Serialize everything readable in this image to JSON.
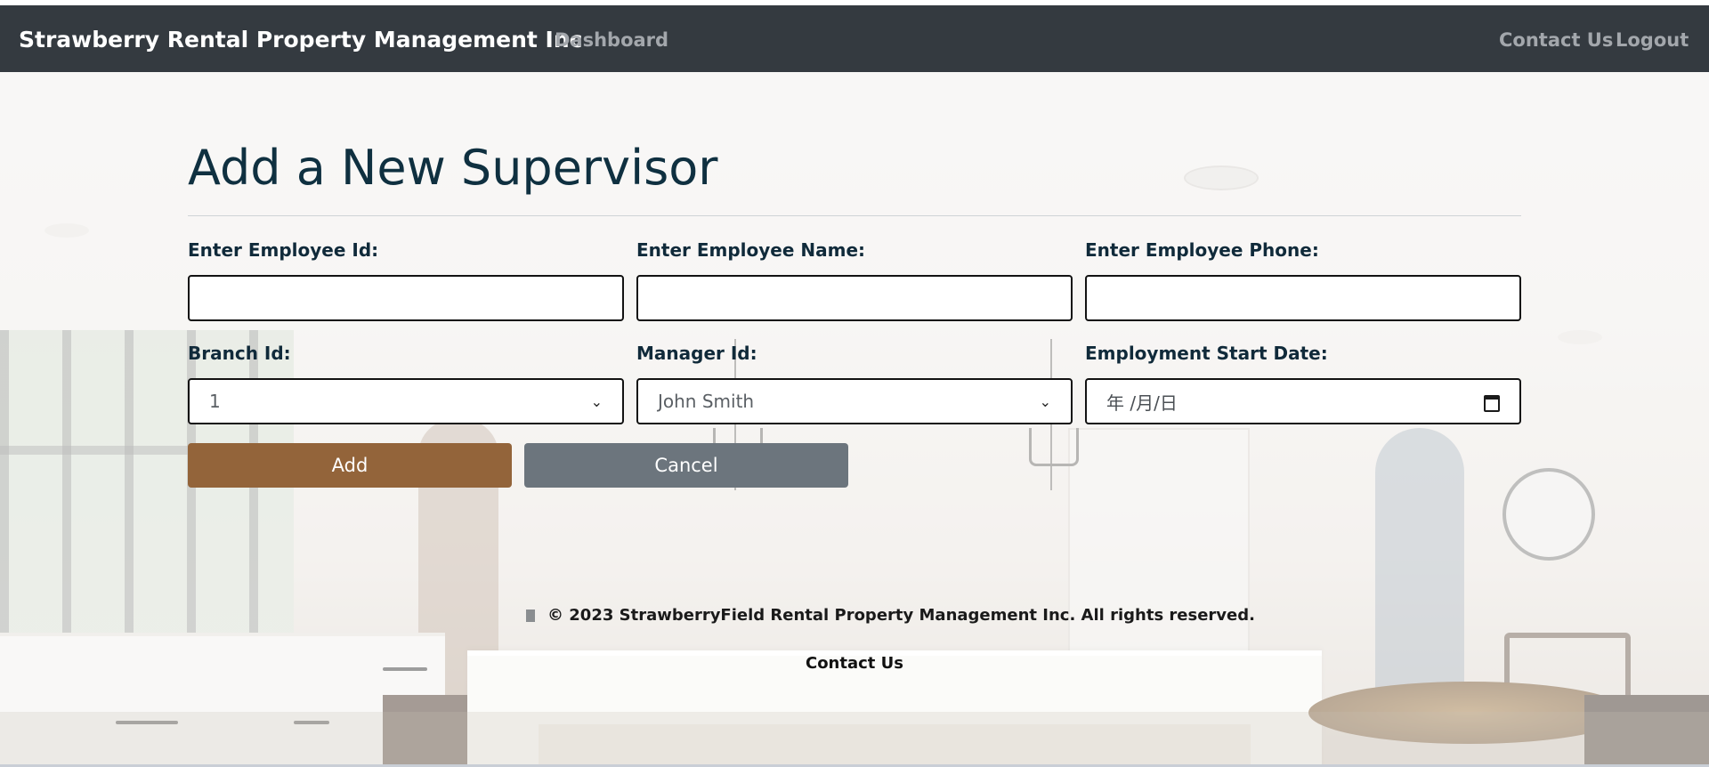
{
  "navbar": {
    "brand": "Strawberry Rental Property Management Inc",
    "links": {
      "dashboard": "Dashboard",
      "contact": "Contact Us",
      "logout": "Logout"
    }
  },
  "form": {
    "title": "Add a New Supervisor",
    "fields": {
      "employee_id": {
        "label": "Enter Employee Id:",
        "value": ""
      },
      "employee_name": {
        "label": "Enter Employee Name:",
        "value": ""
      },
      "employee_phone": {
        "label": "Enter Employee Phone:",
        "value": ""
      },
      "branch_id": {
        "label": "Branch Id:",
        "value": "1"
      },
      "manager_id": {
        "label": "Manager Id:",
        "value": "John Smith"
      },
      "start_date": {
        "label": "Employment Start Date:",
        "placeholder": "年 /月/日"
      }
    },
    "buttons": {
      "add": "Add",
      "cancel": "Cancel"
    }
  },
  "footer": {
    "copyright": "© 2023 StrawberryField Rental Property Management Inc. All rights reserved.",
    "contact": "Contact Us"
  },
  "colors": {
    "navbar": "#343a40",
    "add_button": "#93643a",
    "cancel_button": "#6c757d",
    "title": "#0f3040"
  },
  "icons": {
    "select_chevron": "chevron-down-icon",
    "date_picker": "calendar-icon",
    "footer_marker": "copyright-marker-icon"
  }
}
